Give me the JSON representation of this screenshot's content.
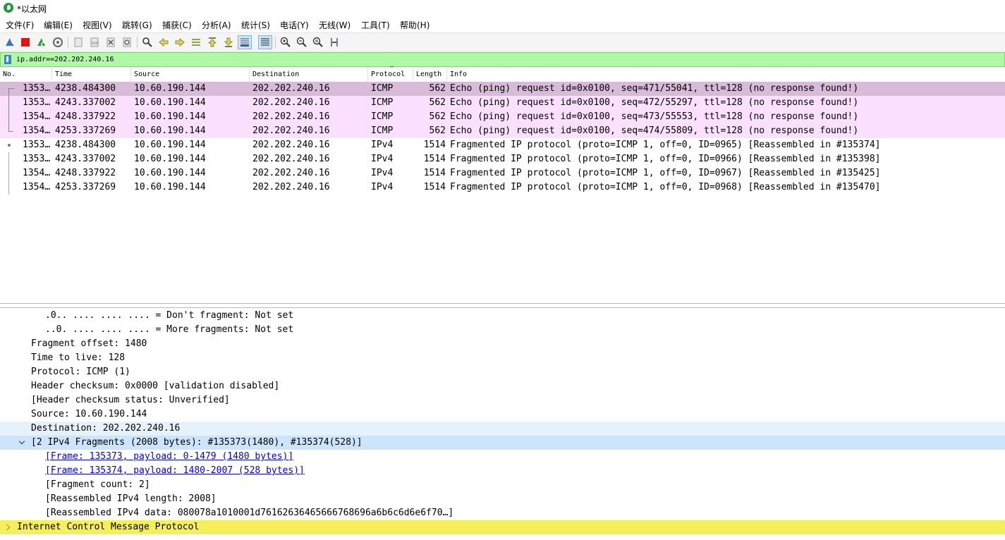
{
  "window": {
    "title": "*以太网"
  },
  "menu": [
    "文件(F)",
    "编辑(E)",
    "视图(V)",
    "跳转(G)",
    "捕获(C)",
    "分析(A)",
    "统计(S)",
    "电话(Y)",
    "无线(W)",
    "工具(T)",
    "帮助(H)"
  ],
  "toolbar": {
    "icons": [
      "shark-fin-start-icon",
      "stop-capture-icon",
      "restart-capture-icon",
      "capture-options-icon",
      "open-file-icon",
      "save-file-icon",
      "close-file-icon",
      "reload-file-icon",
      "find-packet-icon",
      "go-back-icon",
      "go-forward-icon",
      "go-to-packet-icon",
      "go-first-packet-icon",
      "go-last-packet-icon",
      "autoscroll-icon",
      "colorize-icon",
      "zoom-in-icon",
      "zoom-out-icon",
      "normal-size-icon",
      "resize-columns-icon"
    ],
    "active": [
      "autoscroll-icon",
      "colorize-icon"
    ]
  },
  "filter": {
    "value": "ip.addr==202.202.240.16"
  },
  "colors": {
    "icmp_row": "#fce0ff",
    "selected_row": "#d8bbd8",
    "filter_applied": "#aff8a6",
    "highlight_yellow": "#f4ef5a"
  },
  "packet_list": {
    "columns": [
      "No.",
      "Time",
      "Source",
      "Destination",
      "Protocol",
      "Length",
      "Info"
    ],
    "rows": [
      {
        "no": "1353…",
        "time": "4238.484300",
        "source": "10.60.190.144",
        "destination": "202.202.240.16",
        "protocol": "ICMP",
        "length": "562",
        "info": "Echo (ping) request  id=0x0100, seq=471/55041, ttl=128 (no response found!)"
      },
      {
        "no": "1353…",
        "time": "4243.337002",
        "source": "10.60.190.144",
        "destination": "202.202.240.16",
        "protocol": "ICMP",
        "length": "562",
        "info": "Echo (ping) request  id=0x0100, seq=472/55297, ttl=128 (no response found!)"
      },
      {
        "no": "1354…",
        "time": "4248.337922",
        "source": "10.60.190.144",
        "destination": "202.202.240.16",
        "protocol": "ICMP",
        "length": "562",
        "info": "Echo (ping) request  id=0x0100, seq=473/55553, ttl=128 (no response found!)"
      },
      {
        "no": "1354…",
        "time": "4253.337269",
        "source": "10.60.190.144",
        "destination": "202.202.240.16",
        "protocol": "ICMP",
        "length": "562",
        "info": "Echo (ping) request  id=0x0100, seq=474/55809, ttl=128 (no response found!)"
      },
      {
        "no": "1353…",
        "time": "4238.484300",
        "source": "10.60.190.144",
        "destination": "202.202.240.16",
        "protocol": "IPv4",
        "length": "1514",
        "info": "Fragmented IP protocol (proto=ICMP 1, off=0, ID=0965) [Reassembled in #135374]"
      },
      {
        "no": "1353…",
        "time": "4243.337002",
        "source": "10.60.190.144",
        "destination": "202.202.240.16",
        "protocol": "IPv4",
        "length": "1514",
        "info": "Fragmented IP protocol (proto=ICMP 1, off=0, ID=0966) [Reassembled in #135398]"
      },
      {
        "no": "1354…",
        "time": "4248.337922",
        "source": "10.60.190.144",
        "destination": "202.202.240.16",
        "protocol": "IPv4",
        "length": "1514",
        "info": "Fragmented IP protocol (proto=ICMP 1, off=0, ID=0967) [Reassembled in #135425]"
      },
      {
        "no": "1354…",
        "time": "4253.337269",
        "source": "10.60.190.144",
        "destination": "202.202.240.16",
        "protocol": "IPv4",
        "length": "1514",
        "info": "Fragmented IP protocol (proto=ICMP 1, off=0, ID=0968) [Reassembled in #135470]"
      }
    ]
  },
  "details": [
    {
      "text": ".0.. .... .... .... = Don't fragment: Not set"
    },
    {
      "text": "..0. .... .... .... = More fragments: Not set"
    },
    {
      "text": "Fragment offset: 1480"
    },
    {
      "text": "Time to live: 128"
    },
    {
      "text": "Protocol: ICMP (1)"
    },
    {
      "text": "Header checksum: 0x0000 [validation disabled]"
    },
    {
      "text": "[Header checksum status: Unverified]"
    },
    {
      "text": "Source: 10.60.190.144"
    },
    {
      "text": "Destination: 202.202.240.16"
    },
    {
      "text": "[2 IPv4 Fragments (2008 bytes): #135373(1480), #135374(528)]"
    },
    {
      "text": "[Frame: 135373, payload: 0-1479 (1480 bytes)]"
    },
    {
      "text": "[Frame: 135374, payload: 1480-2007 (528 bytes)]"
    },
    {
      "text": "[Fragment count: 2]"
    },
    {
      "text": "[Reassembled IPv4 length: 2008]"
    },
    {
      "text": "[Reassembled IPv4 data: 080078a1010001d76162636465666768696a6b6c6d6e6f70…]"
    },
    {
      "text": "Internet Control Message Protocol"
    }
  ]
}
